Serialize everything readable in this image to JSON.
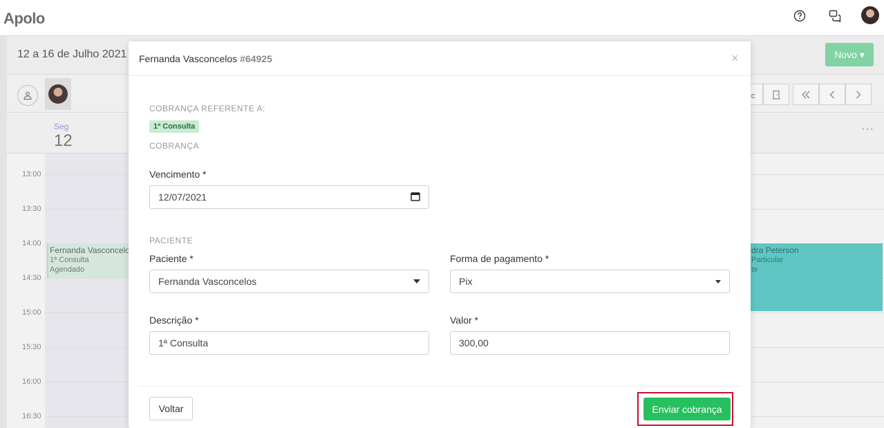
{
  "app": {
    "logo": "Apolo",
    "week_range": "12 a 16 de Julho 2021",
    "new_button": "Novo ▾",
    "day": {
      "name": "Seg",
      "number": "12"
    },
    "more": "···",
    "times": [
      "13:00",
      "13:30",
      "14:00",
      "14:30",
      "15:00",
      "15:30",
      "16:00",
      "16:30"
    ],
    "event_left": {
      "title": "Fernanda Vasconcelos",
      "line1": "1ª Consulta",
      "line2": "Agendado"
    },
    "event_right": {
      "title": "dra Peterson",
      "line1": "Particular",
      "line2": "te"
    },
    "colors": {
      "accent_green": "#27c05f",
      "event_teal": "#5fc6c4",
      "highlight_red": "#c8102e"
    }
  },
  "modal": {
    "title": "Fernanda Vasconcelos",
    "record_id": "#64925",
    "close": "×",
    "billing_ref_label": "COBRANÇA REFERENTE A:",
    "billing_ref_tag": "1ª Consulta",
    "billing_section": "COBRANÇA",
    "due_date_label": "Vencimento *",
    "due_date_value": "12/07/2021",
    "patient_section": "PACIENTE",
    "patient_label": "Paciente *",
    "patient_value": "Fernanda Vasconcelos",
    "payment_label": "Forma de pagamento *",
    "payment_value": "Pix",
    "description_label": "Descrição *",
    "description_value": "1ª Consulta",
    "amount_label": "Valor *",
    "amount_value": "300,00",
    "back_button": "Voltar",
    "send_button": "Enviar cobrança"
  }
}
